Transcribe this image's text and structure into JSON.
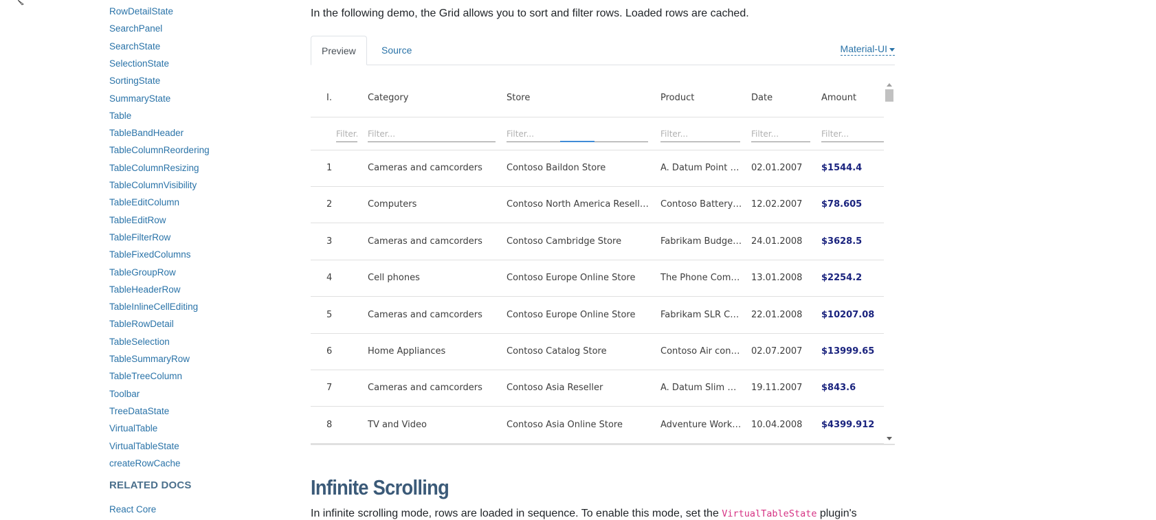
{
  "sidebar": {
    "items": [
      "RowDetailState",
      "SearchPanel",
      "SearchState",
      "SelectionState",
      "SortingState",
      "SummaryState",
      "Table",
      "TableBandHeader",
      "TableColumnReordering",
      "TableColumnResizing",
      "TableColumnVisibility",
      "TableEditColumn",
      "TableEditRow",
      "TableFilterRow",
      "TableFixedColumns",
      "TableGroupRow",
      "TableHeaderRow",
      "TableInlineCellEditing",
      "TableRowDetail",
      "TableSelection",
      "TableSummaryRow",
      "TableTreeColumn",
      "Toolbar",
      "TreeDataState",
      "VirtualTable",
      "VirtualTableState",
      "createRowCache"
    ],
    "related_heading": "RELATED DOCS",
    "related_items": [
      "React Core"
    ]
  },
  "intro_text": "In the following demo, the Grid allows you to sort and filter rows. Loaded rows are cached.",
  "tabs": {
    "preview": "Preview",
    "source": "Source"
  },
  "theme_select": "Material-UI",
  "grid": {
    "columns": [
      "I.",
      "Category",
      "Store",
      "Product",
      "Date",
      "Amount"
    ],
    "filter_placeholders": [
      "Filter...",
      "Filter...",
      "Filter...",
      "Filter...",
      "Filter...",
      "Filter..."
    ],
    "rows": [
      [
        "1",
        "Cameras and camcorders",
        "Contoso Baildon Store",
        "A. Datum Point …",
        "02.01.2007",
        "$1544.4"
      ],
      [
        "2",
        "Computers",
        "Contoso North America Resell…",
        "Contoso Battery…",
        "12.02.2007",
        "$78.605"
      ],
      [
        "3",
        "Cameras and camcorders",
        "Contoso Cambridge Store",
        "Fabrikam Budge…",
        "24.01.2008",
        "$3628.5"
      ],
      [
        "4",
        "Cell phones",
        "Contoso Europe Online Store",
        "The Phone Com…",
        "13.01.2008",
        "$2254.2"
      ],
      [
        "5",
        "Cameras and camcorders",
        "Contoso Europe Online Store",
        "Fabrikam SLR C…",
        "22.01.2008",
        "$10207.08"
      ],
      [
        "6",
        "Home Appliances",
        "Contoso Catalog Store",
        "Contoso Air con…",
        "02.07.2007",
        "$13999.65"
      ],
      [
        "7",
        "Cameras and camcorders",
        "Contoso Asia Reseller",
        "A. Datum Slim D…",
        "19.11.2007",
        "$843.6"
      ],
      [
        "8",
        "TV and Video",
        "Contoso Asia Online Store",
        "Adventure Work…",
        "10.04.2008",
        "$4399.912"
      ]
    ]
  },
  "section": {
    "title": "Infinite Scrolling",
    "para_before": "In infinite scrolling mode, rows are loaded in sequence. To enable this mode, set the ",
    "para_code": "VirtualTableState",
    "para_after": " plugin's"
  },
  "colors": {
    "link": "#2a73a8",
    "amount": "#1a237e",
    "heading": "#3b5a78",
    "code": "#d63384"
  }
}
